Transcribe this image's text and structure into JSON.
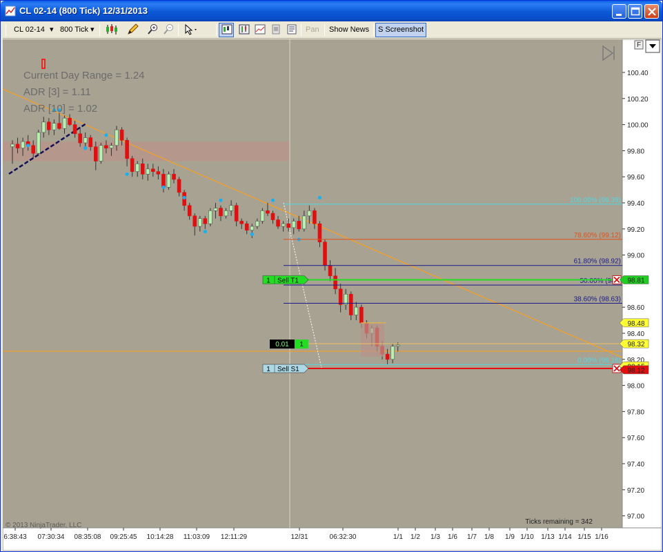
{
  "window": {
    "title": "CL 02-14 (800 Tick)  12/31/2013"
  },
  "toolbar": {
    "instrument": "CL 02-14",
    "interval": "800 Tick",
    "pan_label": "Pan",
    "show_news_label": "Show News",
    "screenshot_label": "S Screenshot"
  },
  "chart": {
    "bg_color": "#a8a292",
    "info_lines": [
      "Current Day Range = 1.24",
      "ADR [3] = 1.11",
      "ADR [10] = 1.02"
    ],
    "copyright": "© 2013 NinjaTrader, LLC",
    "ticks_remaining": "Ticks remaining = 342",
    "y_range": [
      96.92,
      100.56
    ],
    "y_ticks": [
      "100.40",
      "100.20",
      "100.00",
      "99.80",
      "99.60",
      "99.40",
      "99.20",
      "99.00",
      "98.80",
      "98.60",
      "98.40",
      "98.20",
      "98.00",
      "97.80",
      "97.60",
      "97.40",
      "97.20",
      "97.00"
    ],
    "x_ticks": [
      "6:38:43",
      "07:30:34",
      "08:35:08",
      "09:25:45",
      "10:14:28",
      "11:03:09",
      "12:11:29",
      "12/31",
      "06:32:30",
      "1/1",
      "1/2",
      "1/3",
      "1/6",
      "1/7",
      "1/8",
      "1/9",
      "1/10",
      "1/13",
      "1/14",
      "1/15",
      "1/16"
    ],
    "fib_levels": [
      {
        "label": "100.00% (99.39)",
        "price": 99.39,
        "color": "#4fd9e6"
      },
      {
        "label": "78.60% (99.12)",
        "price": 99.12,
        "color": "#e0501a"
      },
      {
        "label": "61.80% (98.92)",
        "price": 98.92,
        "color": "#1a1a8c"
      },
      {
        "label": "50.00% (98.7",
        "price": 98.77,
        "color": "#1a1a8c"
      },
      {
        "label": "38.60% (98.63)",
        "price": 98.63,
        "color": "#1a1a8c"
      },
      {
        "label": "0.00% (98.16)",
        "price": 98.16,
        "color": "#4fd9e6"
      }
    ],
    "price_markers": [
      {
        "label": "98.81",
        "price": 98.81,
        "bg": "#22cc22",
        "fg": "#000000"
      },
      {
        "label": "98.48",
        "price": 98.48,
        "bg": "#ffff33",
        "fg": "#000000"
      },
      {
        "label": "98.32",
        "price": 98.32,
        "bg": "#ffff33",
        "fg": "#000000"
      },
      {
        "label": "98.15",
        "price": 98.15,
        "bg": "#ffff33",
        "fg": "#000000"
      },
      {
        "label": "98.12",
        "price": 98.12,
        "bg": "#e01010",
        "fg": "#ffffff"
      }
    ],
    "orders": [
      {
        "qty": "1",
        "label": "Sell T1",
        "price": 98.81,
        "color": "#22dd22",
        "line": "#22dd22"
      },
      {
        "qty": "1",
        "label": "Sell S1",
        "price": 98.13,
        "color": "#add8e6",
        "line": "#e01010"
      }
    ],
    "position": {
      "pnl": "0.01",
      "qty": "1"
    },
    "candles": [
      {
        "o": 99.83,
        "h": 99.88,
        "l": 99.7,
        "c": 99.85
      },
      {
        "o": 99.85,
        "h": 99.9,
        "l": 99.78,
        "c": 99.82
      },
      {
        "o": 99.82,
        "h": 99.9,
        "l": 99.76,
        "c": 99.87
      },
      {
        "o": 99.87,
        "h": 99.92,
        "l": 99.8,
        "c": 99.84
      },
      {
        "o": 99.84,
        "h": 99.88,
        "l": 99.74,
        "c": 99.78
      },
      {
        "o": 99.78,
        "h": 99.96,
        "l": 99.76,
        "c": 99.94
      },
      {
        "o": 99.94,
        "h": 100.06,
        "l": 99.9,
        "c": 100.02
      },
      {
        "o": 100.02,
        "h": 100.05,
        "l": 99.92,
        "c": 99.96
      },
      {
        "o": 99.96,
        "h": 100.04,
        "l": 99.92,
        "c": 100.01
      },
      {
        "o": 100.01,
        "h": 100.09,
        "l": 99.96,
        "c": 99.97
      },
      {
        "o": 99.97,
        "h": 100.07,
        "l": 99.93,
        "c": 100.05
      },
      {
        "o": 100.05,
        "h": 100.08,
        "l": 99.99,
        "c": 100.0
      },
      {
        "o": 100.0,
        "h": 100.03,
        "l": 99.9,
        "c": 99.93
      },
      {
        "o": 99.93,
        "h": 99.98,
        "l": 99.83,
        "c": 99.86
      },
      {
        "o": 99.86,
        "h": 99.94,
        "l": 99.82,
        "c": 99.9
      },
      {
        "o": 99.9,
        "h": 99.92,
        "l": 99.8,
        "c": 99.83
      },
      {
        "o": 99.83,
        "h": 99.87,
        "l": 99.65,
        "c": 99.72
      },
      {
        "o": 99.72,
        "h": 99.86,
        "l": 99.7,
        "c": 99.84
      },
      {
        "o": 99.84,
        "h": 99.88,
        "l": 99.78,
        "c": 99.82
      },
      {
        "o": 99.82,
        "h": 99.86,
        "l": 99.76,
        "c": 99.84
      },
      {
        "o": 99.84,
        "h": 99.99,
        "l": 99.8,
        "c": 99.96
      },
      {
        "o": 99.96,
        "h": 99.98,
        "l": 99.84,
        "c": 99.88
      },
      {
        "o": 99.88,
        "h": 99.9,
        "l": 99.68,
        "c": 99.74
      },
      {
        "o": 99.74,
        "h": 99.76,
        "l": 99.6,
        "c": 99.64
      },
      {
        "o": 99.64,
        "h": 99.72,
        "l": 99.6,
        "c": 99.7
      },
      {
        "o": 99.7,
        "h": 99.74,
        "l": 99.58,
        "c": 99.62
      },
      {
        "o": 99.62,
        "h": 99.7,
        "l": 99.57,
        "c": 99.66
      },
      {
        "o": 99.66,
        "h": 99.7,
        "l": 99.6,
        "c": 99.64
      },
      {
        "o": 99.64,
        "h": 99.68,
        "l": 99.58,
        "c": 99.62
      },
      {
        "o": 99.62,
        "h": 99.66,
        "l": 99.48,
        "c": 99.52
      },
      {
        "o": 99.52,
        "h": 99.64,
        "l": 99.5,
        "c": 99.62
      },
      {
        "o": 99.62,
        "h": 99.66,
        "l": 99.55,
        "c": 99.58
      },
      {
        "o": 99.58,
        "h": 99.6,
        "l": 99.45,
        "c": 99.48
      },
      {
        "o": 99.48,
        "h": 99.5,
        "l": 99.34,
        "c": 99.38
      },
      {
        "o": 99.38,
        "h": 99.4,
        "l": 99.27,
        "c": 99.3
      },
      {
        "o": 99.3,
        "h": 99.32,
        "l": 99.15,
        "c": 99.22
      },
      {
        "o": 99.22,
        "h": 99.3,
        "l": 99.18,
        "c": 99.28
      },
      {
        "o": 99.28,
        "h": 99.3,
        "l": 99.2,
        "c": 99.24
      },
      {
        "o": 99.24,
        "h": 99.36,
        "l": 99.22,
        "c": 99.34
      },
      {
        "o": 99.34,
        "h": 99.4,
        "l": 99.28,
        "c": 99.36
      },
      {
        "o": 99.36,
        "h": 99.38,
        "l": 99.26,
        "c": 99.3
      },
      {
        "o": 99.3,
        "h": 99.36,
        "l": 99.28,
        "c": 99.34
      },
      {
        "o": 99.34,
        "h": 99.42,
        "l": 99.3,
        "c": 99.38
      },
      {
        "o": 99.38,
        "h": 99.4,
        "l": 99.22,
        "c": 99.26
      },
      {
        "o": 99.26,
        "h": 99.28,
        "l": 99.2,
        "c": 99.24
      },
      {
        "o": 99.24,
        "h": 99.26,
        "l": 99.16,
        "c": 99.19
      },
      {
        "o": 99.19,
        "h": 99.24,
        "l": 99.13,
        "c": 99.22
      },
      {
        "o": 99.22,
        "h": 99.28,
        "l": 99.2,
        "c": 99.26
      },
      {
        "o": 99.26,
        "h": 99.36,
        "l": 99.24,
        "c": 99.34
      },
      {
        "o": 99.34,
        "h": 99.4,
        "l": 99.3,
        "c": 99.32
      },
      {
        "o": 99.32,
        "h": 99.34,
        "l": 99.24,
        "c": 99.27
      },
      {
        "o": 99.27,
        "h": 99.3,
        "l": 99.2,
        "c": 99.22
      },
      {
        "o": 99.22,
        "h": 99.26,
        "l": 99.18,
        "c": 99.24
      },
      {
        "o": 99.24,
        "h": 99.28,
        "l": 99.18,
        "c": 99.21
      },
      {
        "o": 99.21,
        "h": 99.28,
        "l": 99.16,
        "c": 99.26
      },
      {
        "o": 99.26,
        "h": 99.3,
        "l": 99.18,
        "c": 99.2
      },
      {
        "o": 99.2,
        "h": 99.34,
        "l": 99.18,
        "c": 99.3
      },
      {
        "o": 99.3,
        "h": 99.38,
        "l": 99.24,
        "c": 99.34
      },
      {
        "o": 99.34,
        "h": 99.36,
        "l": 99.2,
        "c": 99.24
      },
      {
        "o": 99.24,
        "h": 99.26,
        "l": 99.06,
        "c": 99.1
      },
      {
        "o": 99.1,
        "h": 99.12,
        "l": 98.88,
        "c": 98.92
      },
      {
        "o": 98.92,
        "h": 98.96,
        "l": 98.8,
        "c": 98.84
      },
      {
        "o": 98.84,
        "h": 98.9,
        "l": 98.7,
        "c": 98.74
      },
      {
        "o": 98.74,
        "h": 98.78,
        "l": 98.56,
        "c": 98.62
      },
      {
        "o": 98.62,
        "h": 98.74,
        "l": 98.58,
        "c": 98.7
      },
      {
        "o": 98.7,
        "h": 98.72,
        "l": 98.5,
        "c": 98.54
      },
      {
        "o": 98.54,
        "h": 98.64,
        "l": 98.5,
        "c": 98.6
      },
      {
        "o": 98.6,
        "h": 98.62,
        "l": 98.44,
        "c": 98.48
      },
      {
        "o": 98.48,
        "h": 98.5,
        "l": 98.36,
        "c": 98.4
      },
      {
        "o": 98.4,
        "h": 98.46,
        "l": 98.3,
        "c": 98.44
      },
      {
        "o": 98.44,
        "h": 98.46,
        "l": 98.26,
        "c": 98.3
      },
      {
        "o": 98.3,
        "h": 98.34,
        "l": 98.2,
        "c": 98.24
      },
      {
        "o": 98.24,
        "h": 98.28,
        "l": 98.16,
        "c": 98.2
      },
      {
        "o": 98.2,
        "h": 98.32,
        "l": 98.17,
        "c": 98.3
      },
      {
        "o": 98.3,
        "h": 98.33,
        "l": 98.26,
        "c": 98.31
      }
    ]
  }
}
